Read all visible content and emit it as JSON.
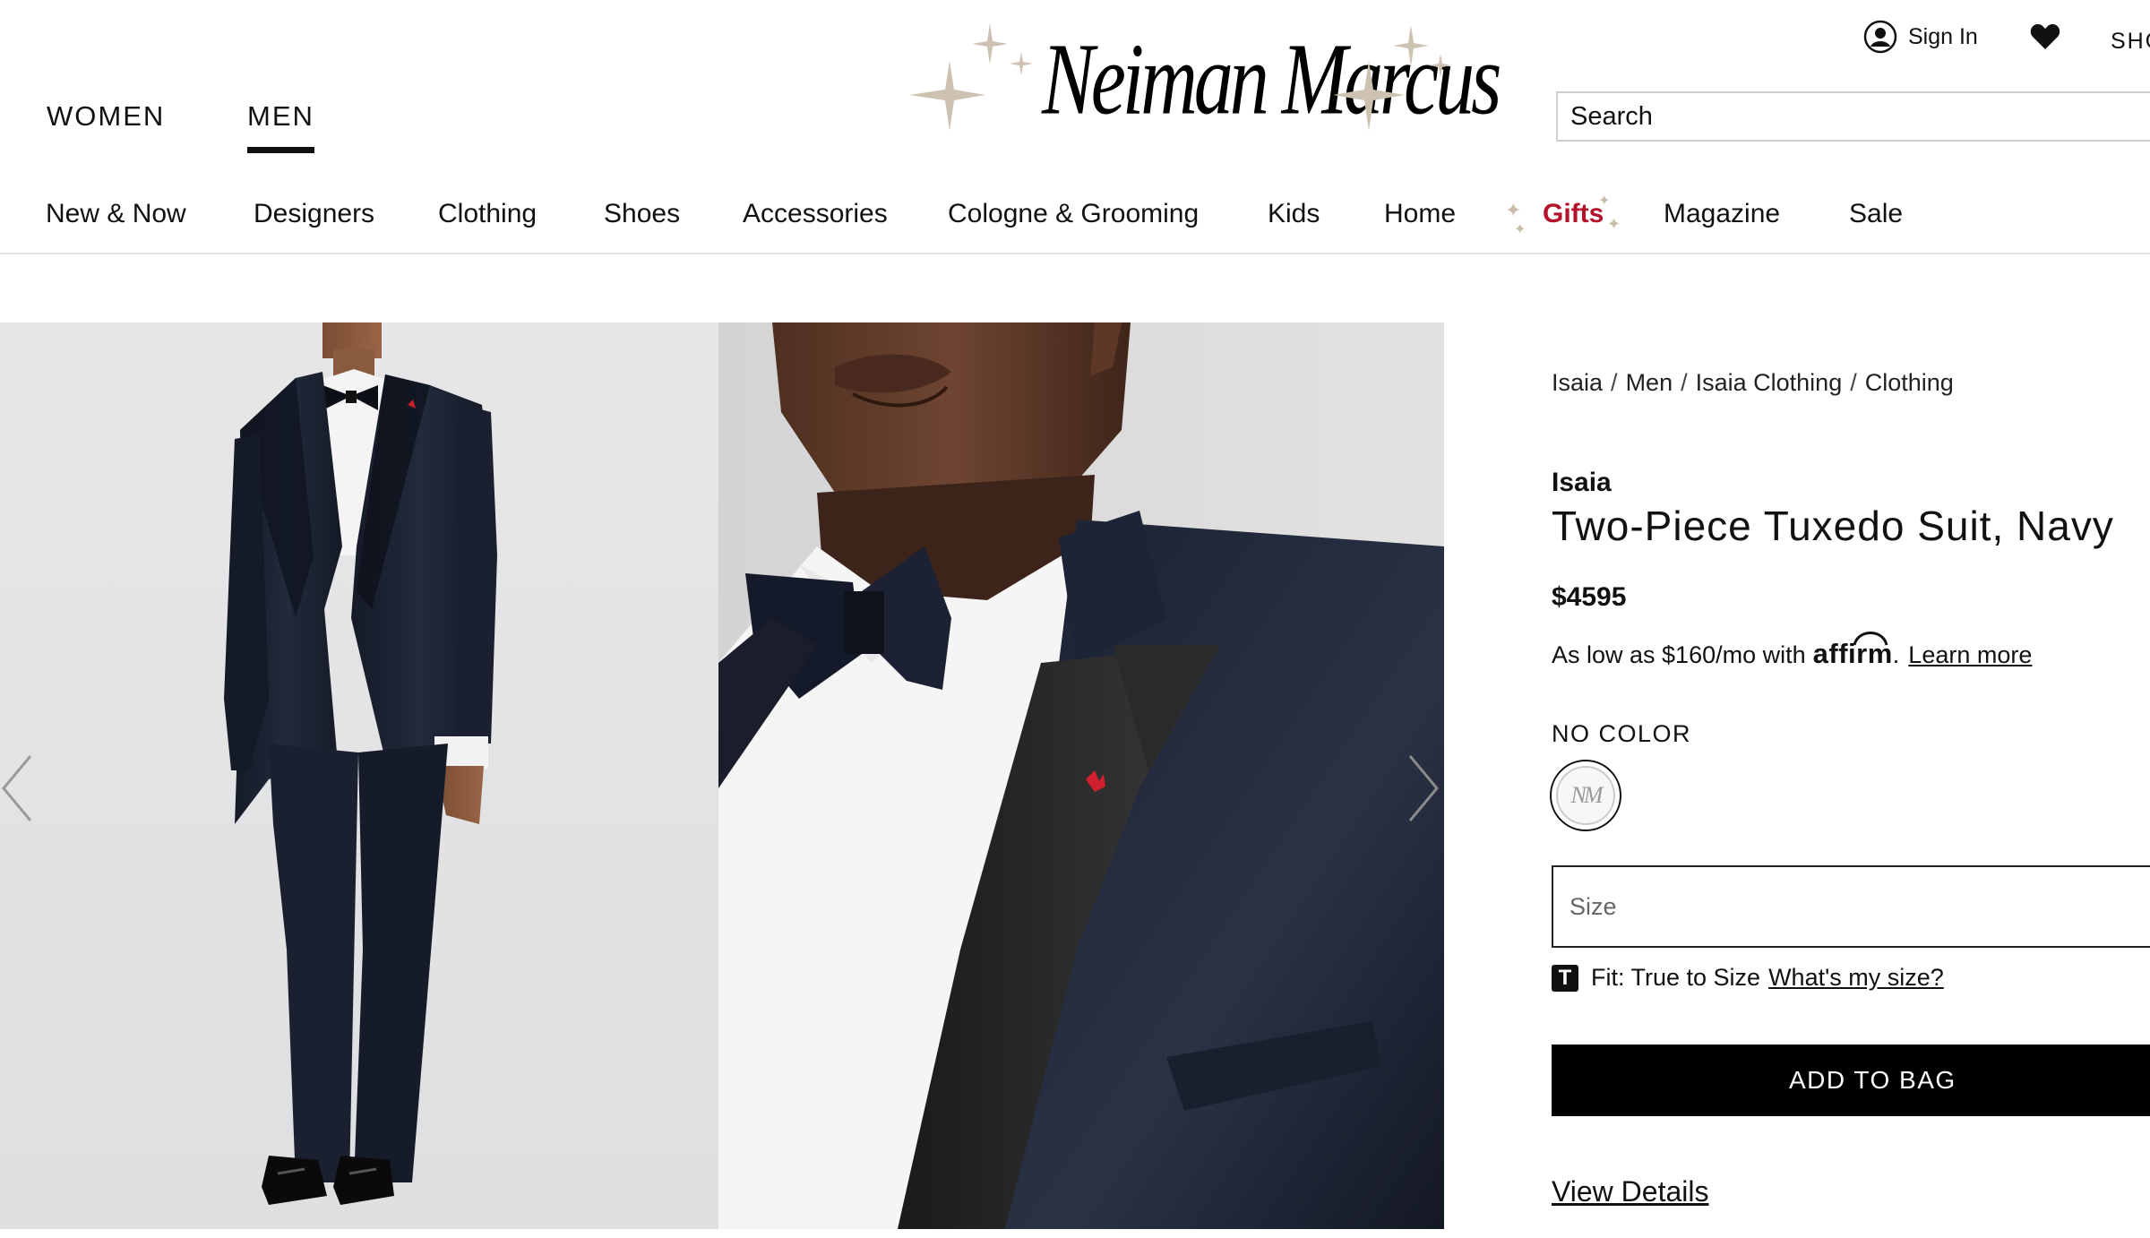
{
  "header": {
    "genders": [
      "WOMEN",
      "MEN"
    ],
    "active_gender": "MEN",
    "logo_text": "Neiman Marcus",
    "sign_in_label": "Sign In",
    "shop_label": "SHOP",
    "search_placeholder": "Search"
  },
  "nav": {
    "items": [
      "New & Now",
      "Designers",
      "Clothing",
      "Shoes",
      "Accessories",
      "Cologne & Grooming",
      "Kids",
      "Home",
      "Gifts",
      "Magazine",
      "Sale"
    ]
  },
  "product": {
    "breadcrumb": [
      "Isaia",
      "Men",
      "Isaia Clothing",
      "Clothing"
    ],
    "brand": "Isaia",
    "title": "Two-Piece Tuxedo Suit, Navy",
    "price": "$4595",
    "affirm_prefix": "As low as $160/mo with",
    "affirm_brand": "affirm",
    "affirm_period": ".",
    "affirm_link": "Learn more",
    "color_label": "NO COLOR",
    "swatch_monogram": "NM",
    "size_placeholder": "Size",
    "fit_badge": "T",
    "fit_text": "Fit: True to Size",
    "fit_link": "What's my size?",
    "add_to_bag": "ADD TO BAG",
    "view_details": "View Details"
  },
  "colors": {
    "gifts_red": "#b3122a",
    "sparkle_gold": "#cbbfae",
    "button_black": "#000000",
    "suit_navy": "#1c2233"
  }
}
